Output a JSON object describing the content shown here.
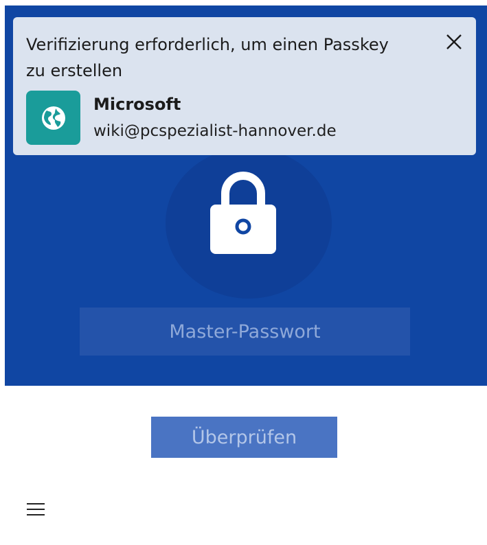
{
  "dialog": {
    "title": "Verifizierung erforderlich, um einen Passkey zu erstellen",
    "site_name": "Microsoft",
    "account": "wiki@pcspezialist-hannover.de",
    "site_icon": "globe-icon",
    "close_icon": "close-icon"
  },
  "unlock": {
    "lock_icon": "lock-icon",
    "password_placeholder": "Master-Passwort",
    "verify_label": "Überprüfen"
  },
  "footer": {
    "menu_icon": "hamburger-menu-icon"
  },
  "colors": {
    "panel_blue": "#1046a3",
    "dialog_bg": "#dbe3ef",
    "site_tile": "#1a9c9a",
    "button_blue": "#4a74c3"
  }
}
